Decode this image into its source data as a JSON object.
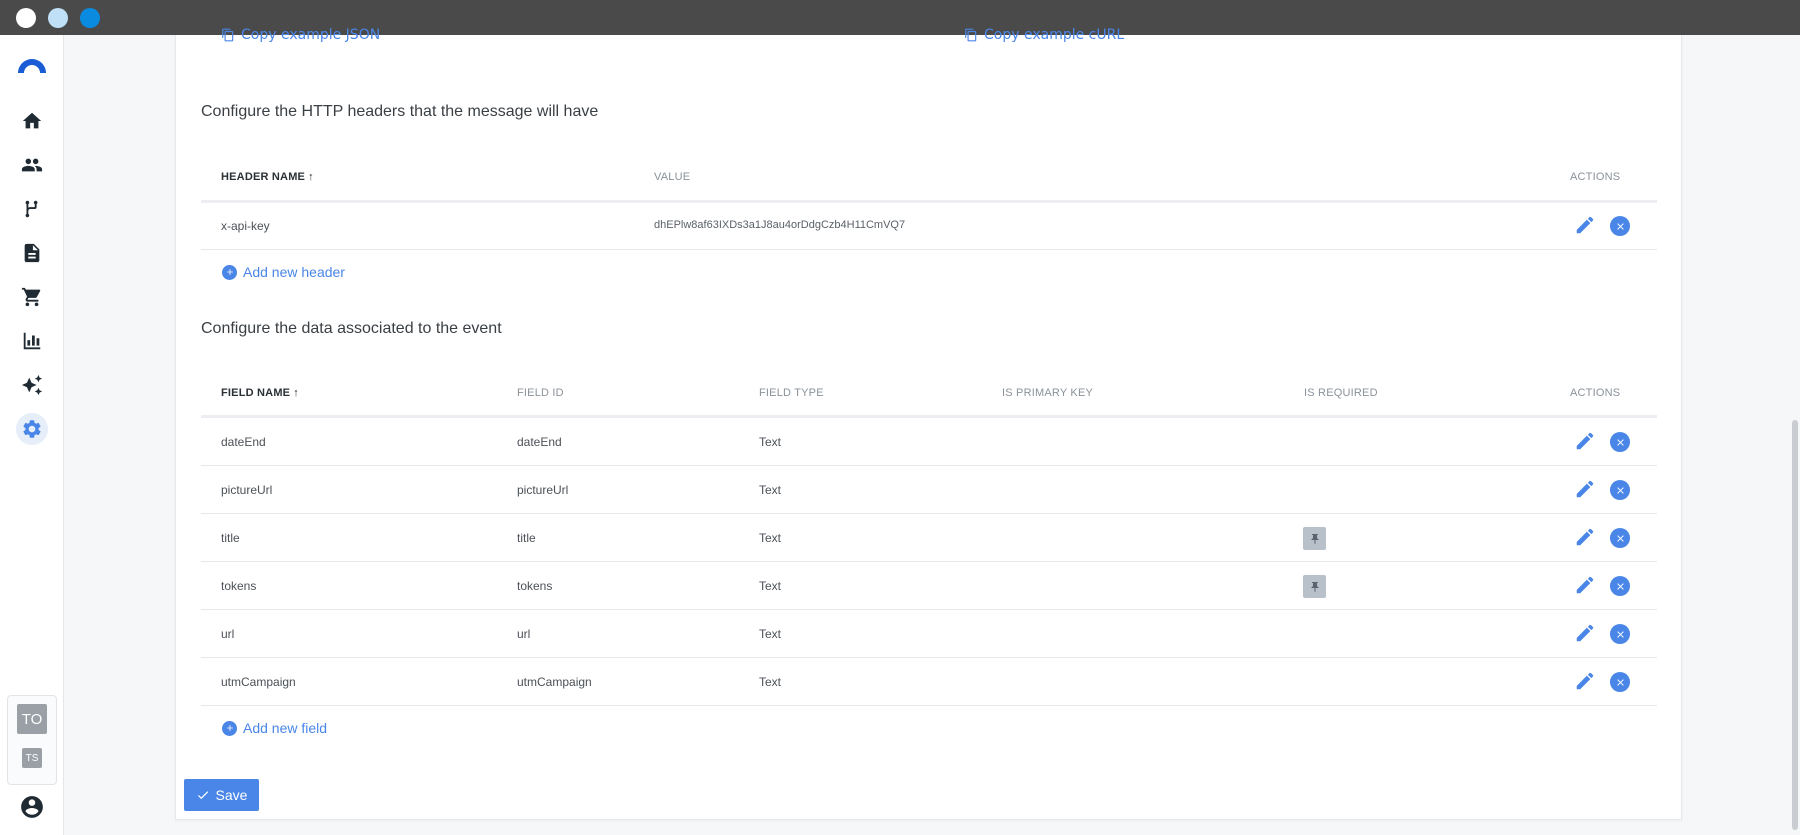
{
  "nav": {
    "items": [
      {
        "name": "home-icon"
      },
      {
        "name": "people-icon"
      },
      {
        "name": "flow-icon"
      },
      {
        "name": "document-icon"
      },
      {
        "name": "cart-icon"
      },
      {
        "name": "chart-icon"
      },
      {
        "name": "sparkle-icon"
      },
      {
        "name": "gear-icon",
        "active": true
      }
    ],
    "account_primary": "TO",
    "account_secondary": "TS"
  },
  "top_links": {
    "left": "Copy example JSON",
    "right": "Copy example cURL"
  },
  "headers_section": {
    "title": "Configure the HTTP headers that the message will have",
    "columns": {
      "name": "HEADER NAME",
      "value": "VALUE",
      "actions": "ACTIONS"
    },
    "rows": [
      {
        "name": "x-api-key",
        "value": "dhEPlw8af63IXDs3a1J8au4orDdgCzb4H11CmVQ7"
      }
    ],
    "add_label": "Add new header"
  },
  "fields_section": {
    "title": "Configure the data associated to the event",
    "columns": {
      "name": "FIELD NAME",
      "id": "FIELD ID",
      "type": "FIELD TYPE",
      "primary": "IS PRIMARY KEY",
      "required": "IS REQUIRED",
      "actions": "ACTIONS"
    },
    "rows": [
      {
        "name": "dateEnd",
        "id": "dateEnd",
        "type": "Text",
        "required": false
      },
      {
        "name": "pictureUrl",
        "id": "pictureUrl",
        "type": "Text",
        "required": false
      },
      {
        "name": "title",
        "id": "title",
        "type": "Text",
        "required": true
      },
      {
        "name": "tokens",
        "id": "tokens",
        "type": "Text",
        "required": true
      },
      {
        "name": "url",
        "id": "url",
        "type": "Text",
        "required": false
      },
      {
        "name": "utmCampaign",
        "id": "utmCampaign",
        "type": "Text",
        "required": false
      }
    ],
    "add_label": "Add new field"
  },
  "save_label": "Save",
  "colors": {
    "accent": "#4a86e8",
    "titlebar": "#4a4a4a"
  }
}
